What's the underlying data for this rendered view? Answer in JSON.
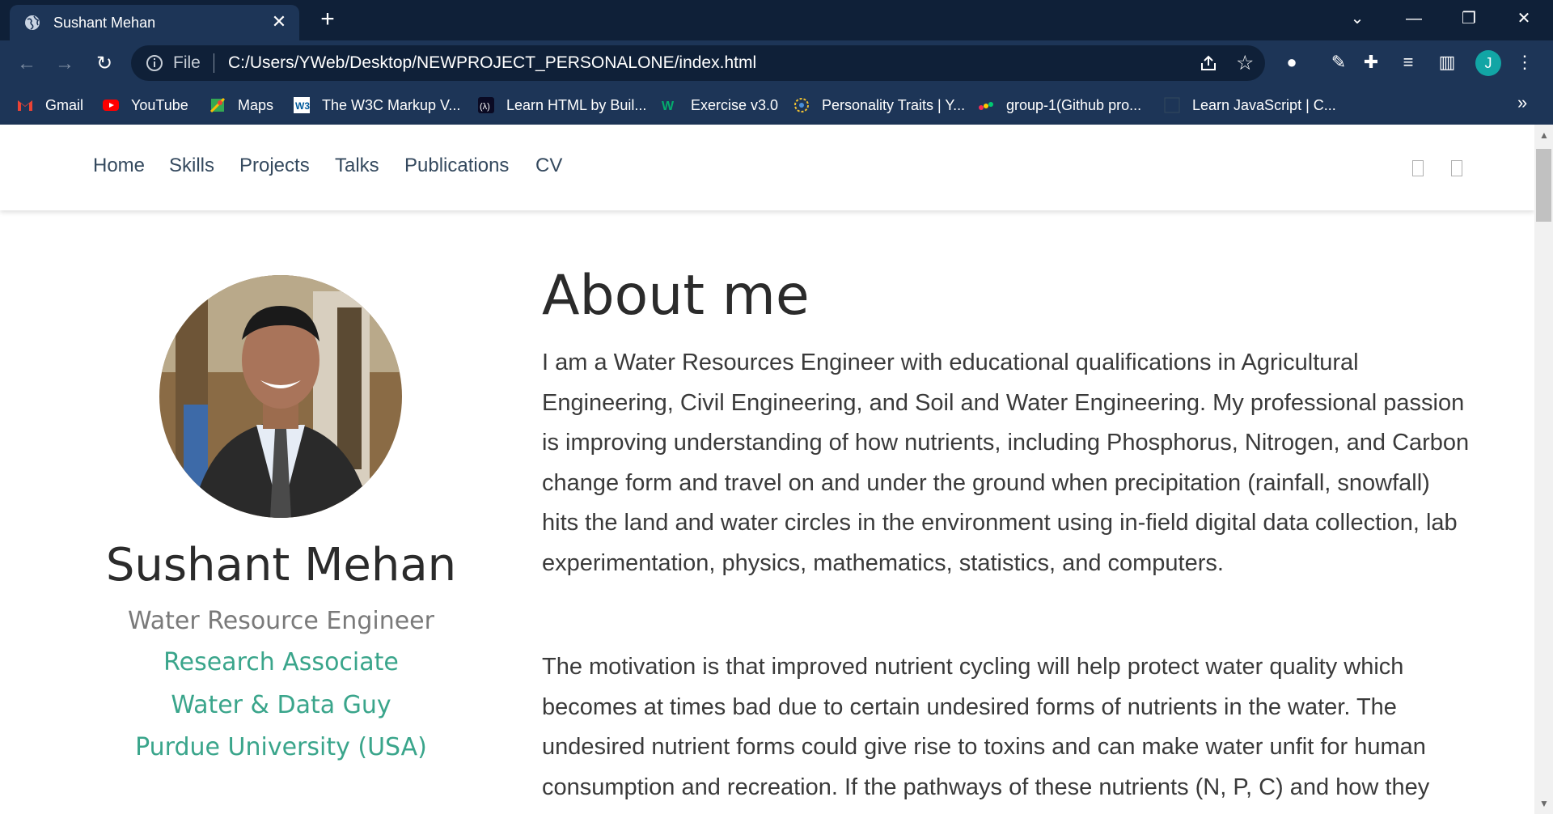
{
  "browser": {
    "tab_title": "Sushant Mehan",
    "file_label": "File",
    "url": "C:/Users/YWeb/Desktop/NEWPROJECT_PERSONALONE/index.html",
    "profile_initial": "J",
    "bookmarks": [
      {
        "label": "Gmail",
        "icon": "gmail-icon"
      },
      {
        "label": "YouTube",
        "icon": "youtube-icon"
      },
      {
        "label": "Maps",
        "icon": "maps-icon"
      },
      {
        "label": "The W3C Markup V...",
        "icon": "w3c-icon"
      },
      {
        "label": "Learn HTML by Buil...",
        "icon": "freecodecamp-icon"
      },
      {
        "label": "Exercise v3.0",
        "icon": "w3schools-icon"
      },
      {
        "label": "Personality Traits | Y...",
        "icon": "personality-icon"
      },
      {
        "label": "group-1(Github pro...",
        "icon": "monday-icon"
      },
      {
        "label": "Learn JavaScript | C...",
        "icon": "codecademy-icon"
      }
    ]
  },
  "nav": {
    "links": [
      "Home",
      "Skills",
      "Projects",
      "Talks",
      "Publications",
      "CV"
    ]
  },
  "profile": {
    "name": "Sushant Mehan",
    "role": "Water Resource Engineer",
    "affiliations": [
      "Research Associate",
      "Water & Data Guy",
      "Purdue University (USA)"
    ]
  },
  "about": {
    "heading": "About me",
    "paragraphs": [
      "I am a Water Resources Engineer with educational qualifications in Agricultural Engineering, Civil Engineering, and Soil and Water Engineering. My professional passion is improving understanding of how nutrients, including Phosphorus, Nitrogen, and Carbon change form and travel on and under the ground when precipitation (rainfall, snowfall) hits the land and water circles in the environment using in-field digital data collection, lab experimentation, physics, mathematics, statistics, and computers.",
      "The motivation is that improved nutrient cycling will help protect water quality which becomes at times bad due to certain undesired forms of nutrients in the water. The undesired nutrient forms could give rise to toxins and can make water unfit for human consumption and recreation. If the pathways of these nutrients (N, P, C) and how they"
    ]
  },
  "colors": {
    "accent": "#3aa58b",
    "chrome_bg": "#1d3557",
    "tabstrip_bg": "#0f2038"
  }
}
